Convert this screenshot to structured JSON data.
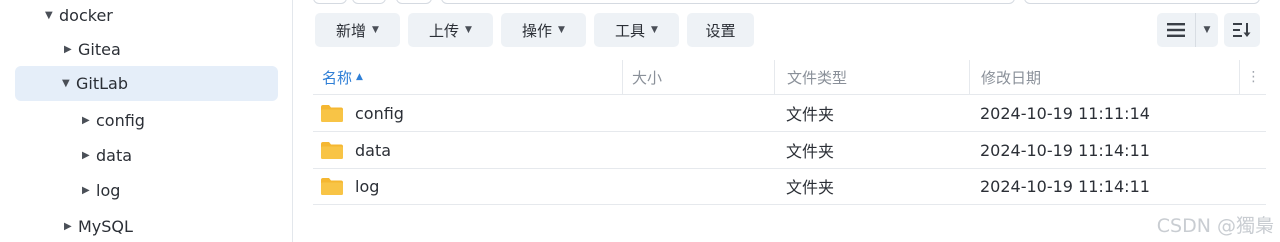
{
  "sidebar": {
    "items": [
      {
        "label": "docker",
        "expanded": true
      },
      {
        "label": "Gitea",
        "expanded": false
      },
      {
        "label": "GitLab",
        "expanded": true,
        "selected": true
      },
      {
        "label": "config",
        "expanded": false
      },
      {
        "label": "data",
        "expanded": false
      },
      {
        "label": "log",
        "expanded": false
      },
      {
        "label": "MySQL",
        "expanded": false
      }
    ]
  },
  "toolbar": {
    "create_label": "新增",
    "upload_label": "上传",
    "action_label": "操作",
    "tools_label": "工具",
    "settings_label": "设置"
  },
  "table": {
    "columns": {
      "name": "名称",
      "size": "大小",
      "type": "文件类型",
      "modified": "修改日期"
    },
    "sort": {
      "column": "name",
      "direction": "ascending"
    },
    "rows": [
      {
        "name": "config",
        "size": "",
        "type": "文件夹",
        "modified": "2024-10-19 11:11:14"
      },
      {
        "name": "data",
        "size": "",
        "type": "文件夹",
        "modified": "2024-10-19 11:14:11"
      },
      {
        "name": "log",
        "size": "",
        "type": "文件夹",
        "modified": "2024-10-19 11:14:11"
      }
    ]
  },
  "watermark": "CSDN @獨梟",
  "colors": {
    "accent": "#2f7fd6",
    "selected_bg": "#e5eef9",
    "folder": "#f5b731",
    "button_bg": "#eef2f6"
  }
}
